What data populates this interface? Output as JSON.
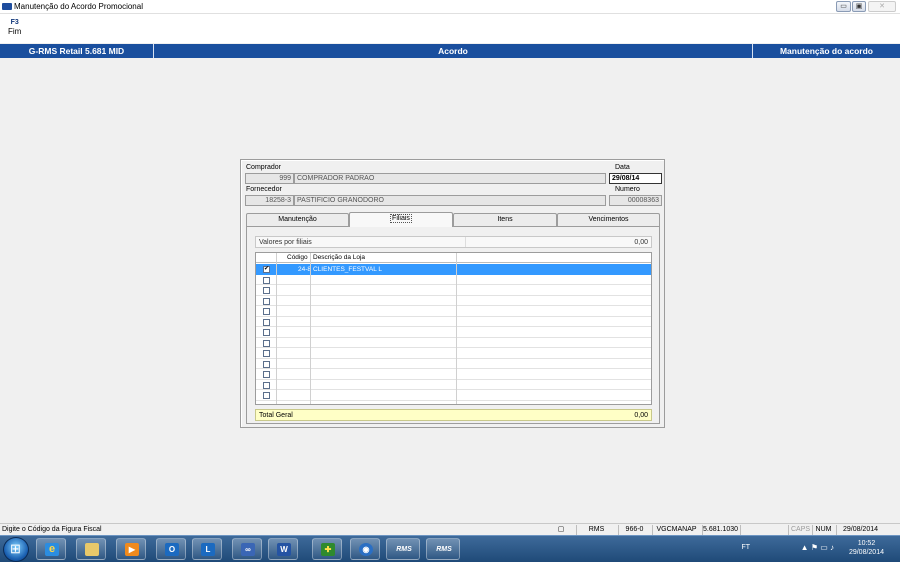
{
  "window": {
    "title": "Manutenção do Acordo Promocional",
    "controls": [
      "minimize",
      "maximize",
      "close"
    ]
  },
  "fkeys": [
    {
      "key": "F3",
      "label": "Fim"
    }
  ],
  "header": {
    "left": "G-RMS Retail 5.681 MID",
    "center": "Acordo",
    "right": "Manutenção do acordo"
  },
  "form": {
    "comprador_label": "Comprador",
    "comprador_code": "999",
    "comprador_name": "COMPRADOR PADRAO",
    "data_label": "Data",
    "data_value": "29/08/14",
    "fornecedor_label": "Fornecedor",
    "fornecedor_code": "18258-3",
    "fornecedor_name": "PASTIFICIO GRANODORO",
    "numero_label": "Numero",
    "numero_value": "00008363"
  },
  "tabs": [
    {
      "label": "Manutenção",
      "active": false
    },
    {
      "label": "Filiais",
      "active": true
    },
    {
      "label": "Itens",
      "active": false
    },
    {
      "label": "Vencimentos",
      "active": false
    }
  ],
  "valores": {
    "label": "Valores por filiais",
    "value": "0,00"
  },
  "grid": {
    "col_codigo": "Código",
    "col_descricao": "Descrição da Loja",
    "rows": [
      {
        "checked": true,
        "codigo": "24-8",
        "descricao": "CLIENTES_FESTVAL L",
        "selected": true
      },
      {
        "checked": false,
        "codigo": "",
        "descricao": "",
        "selected": false
      },
      {
        "checked": false,
        "codigo": "",
        "descricao": "",
        "selected": false
      },
      {
        "checked": false,
        "codigo": "",
        "descricao": "",
        "selected": false
      },
      {
        "checked": false,
        "codigo": "",
        "descricao": "",
        "selected": false
      },
      {
        "checked": false,
        "codigo": "",
        "descricao": "",
        "selected": false
      },
      {
        "checked": false,
        "codigo": "",
        "descricao": "",
        "selected": false
      },
      {
        "checked": false,
        "codigo": "",
        "descricao": "",
        "selected": false
      },
      {
        "checked": false,
        "codigo": "",
        "descricao": "",
        "selected": false
      },
      {
        "checked": false,
        "codigo": "",
        "descricao": "",
        "selected": false
      },
      {
        "checked": false,
        "codigo": "",
        "descricao": "",
        "selected": false
      },
      {
        "checked": false,
        "codigo": "",
        "descricao": "",
        "selected": false
      },
      {
        "checked": false,
        "codigo": "",
        "descricao": "",
        "selected": false
      }
    ]
  },
  "total": {
    "label": "Total Geral",
    "value": "0,00"
  },
  "statusbar": {
    "message": "Digite o Código da Figura Fiscal",
    "system": "RMS",
    "filial": "966-0",
    "user": "VGCMANAP",
    "version": "5.681.1030",
    "caps": "CAPS",
    "num": "NUM",
    "date": "29/08/2014"
  },
  "taskbar": {
    "apps": [
      "internet-explorer",
      "file-explorer",
      "media-player",
      "outlook",
      "lync",
      "connect",
      "word",
      "agent",
      "remote-desktop",
      "rms-1",
      "rms-2"
    ],
    "rms_label": "RMS",
    "tray_lang": "FT",
    "clock_time": "10:52",
    "clock_date": "29/08/2014"
  },
  "colors": {
    "header_blue": "#1a4f9e",
    "selection": "#3399ff",
    "total_bg": "#ffffc6"
  }
}
